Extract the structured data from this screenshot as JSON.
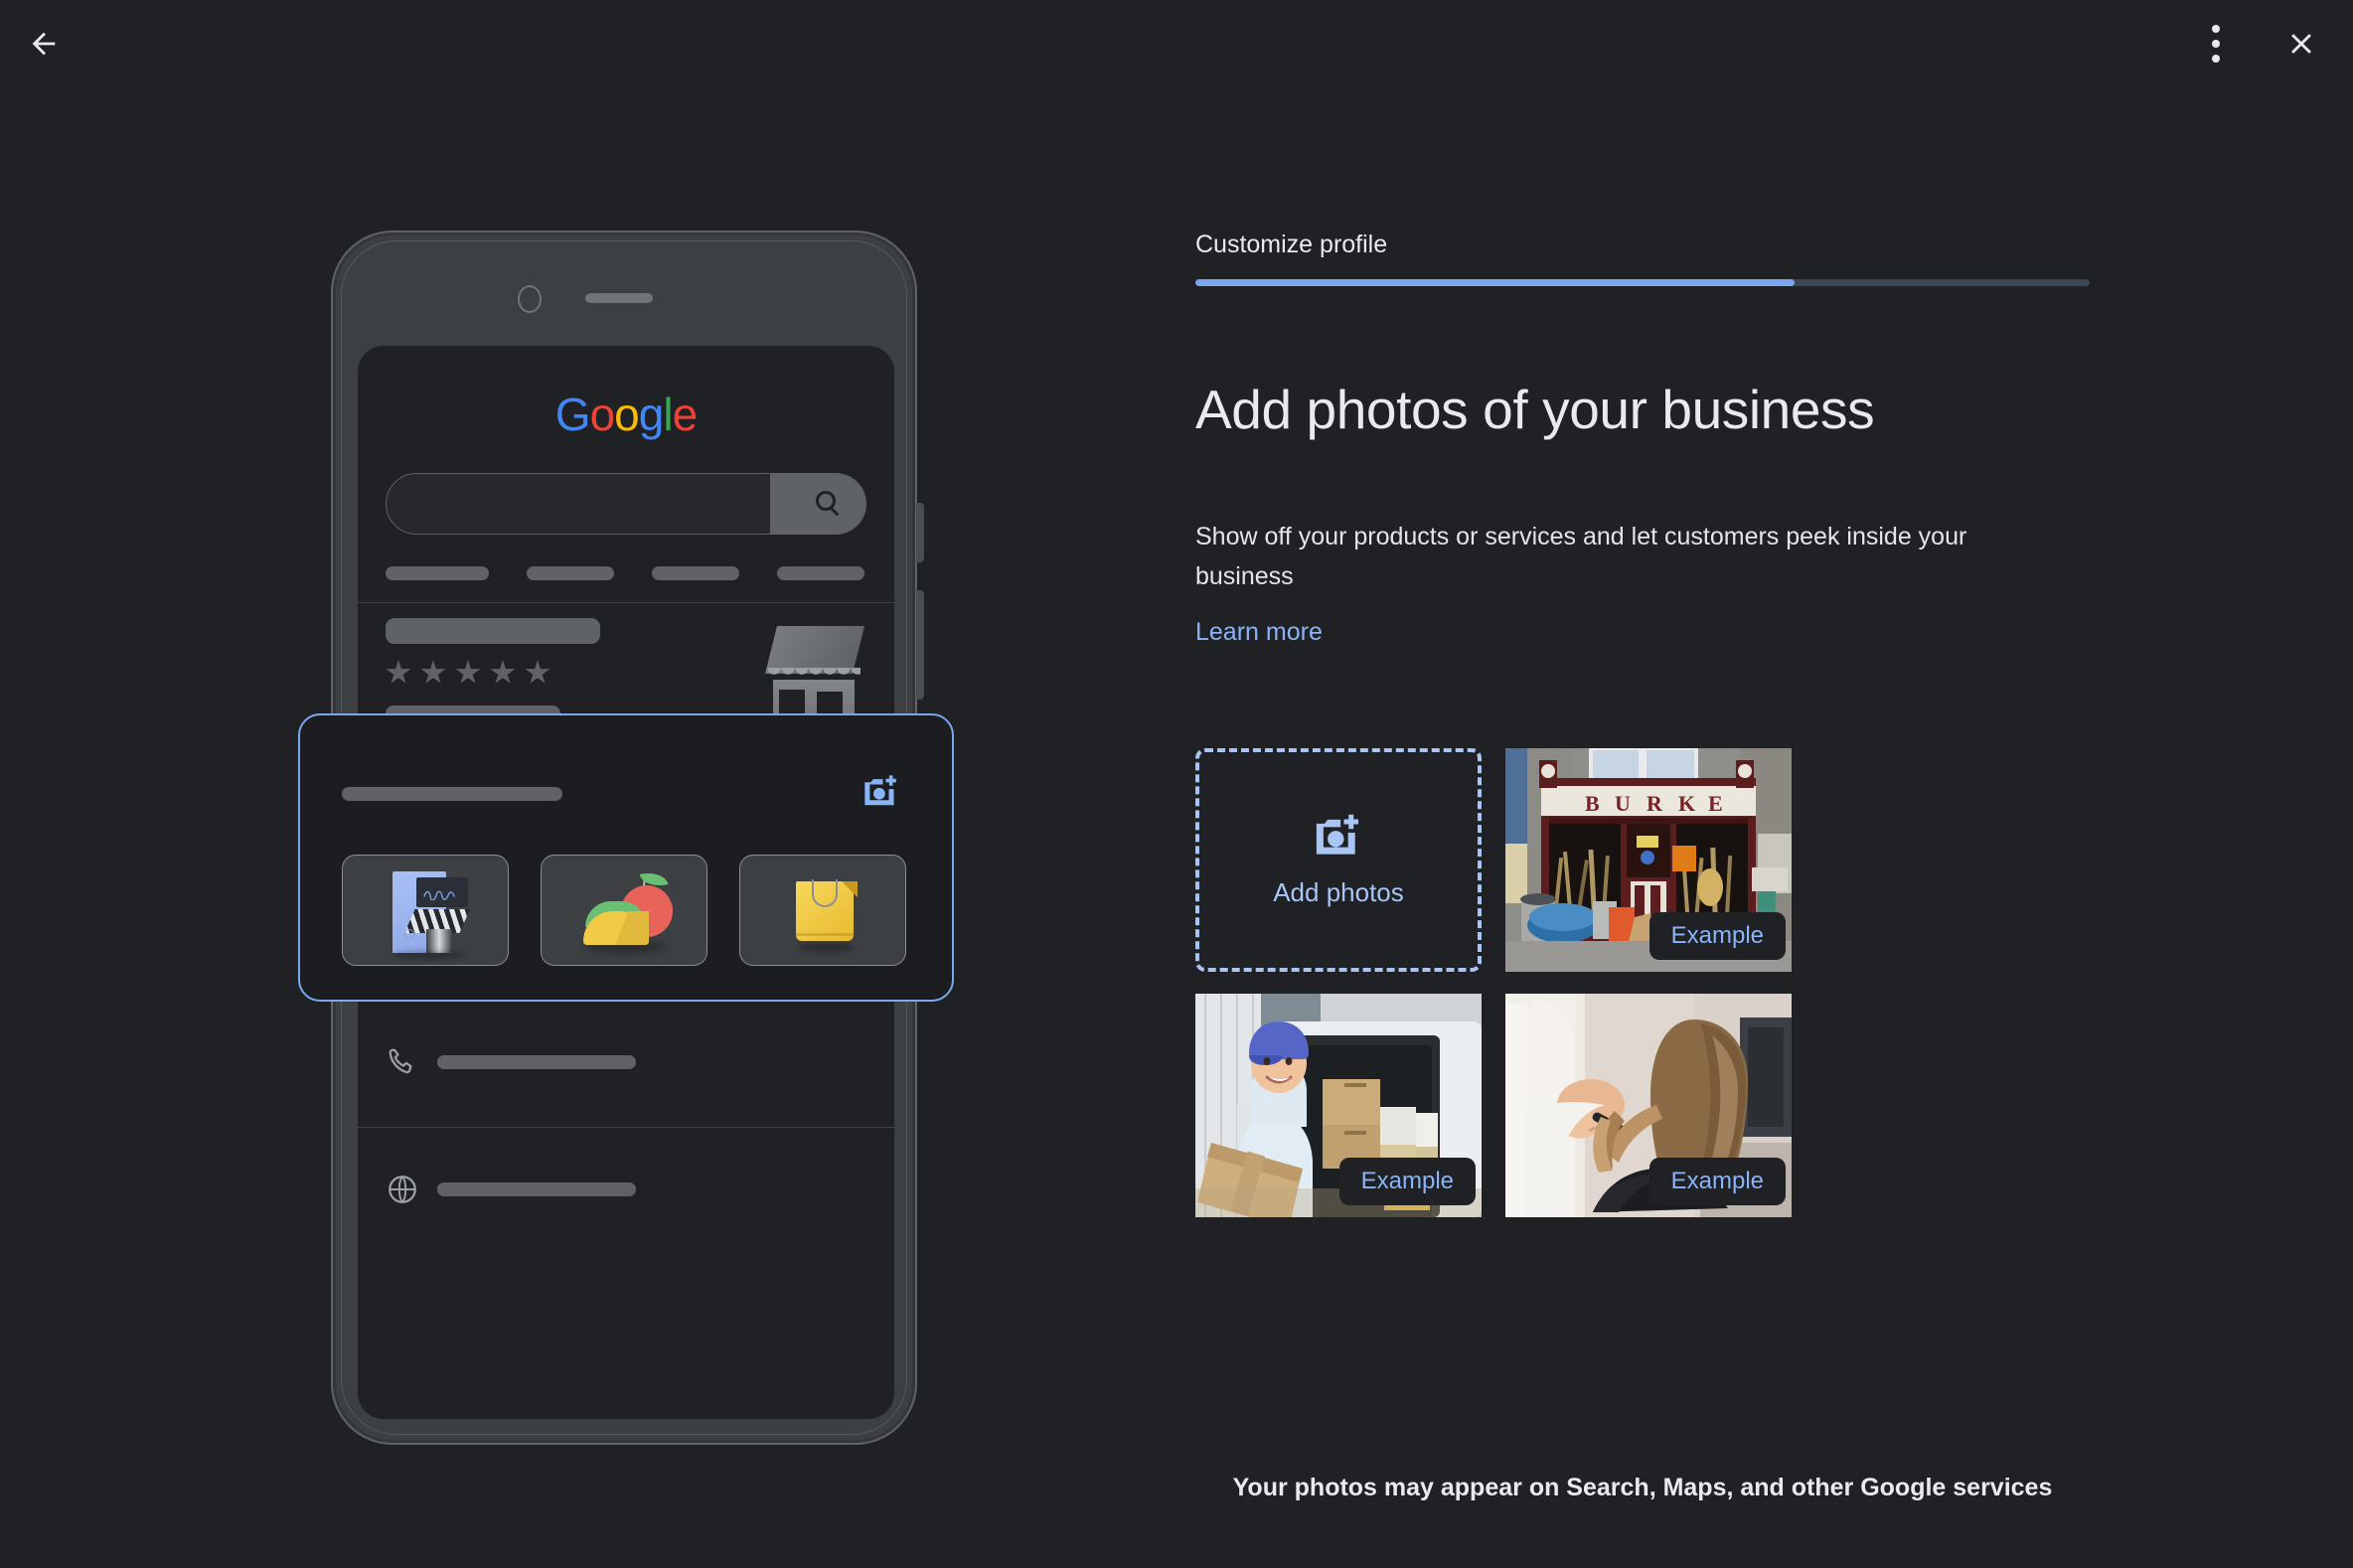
{
  "topbar": {
    "back_icon": "arrow-back-icon",
    "menu_icon": "more-vert-icon",
    "close_icon": "close-icon"
  },
  "progress": {
    "step_label": "Customize profile",
    "percent": 67,
    "fill_color": "#7ba7f0",
    "track_color": "#3c4756"
  },
  "main": {
    "headline": "Add photos of your business",
    "subtext": "Show off your products or services and let customers peek inside your business",
    "learn_more": "Learn more",
    "footer_note": "Your photos may appear on Search, Maps, and other Google services"
  },
  "add_photos": {
    "label": "Add photos",
    "icon": "add-a-photo-icon",
    "accent_color": "#a8c5f5"
  },
  "example_photos": [
    {
      "badge": "Example",
      "alt": "Hardware store front with sign reading BURKE, tools and buckets outside"
    },
    {
      "badge": "Example",
      "alt": "Delivery man in blue cap holding a cardboard box in front of a loaded van"
    },
    {
      "badge": "Example",
      "alt": "Hairdresser combing a woman's long brown hair in a salon"
    }
  ],
  "phone_preview": {
    "google_logo": [
      "G",
      "o",
      "o",
      "g",
      "l",
      "e"
    ],
    "search_icon": "search-icon",
    "rating_stars": 5,
    "info_rows": [
      {
        "icon": "location-pin-icon"
      },
      {
        "icon": "clock-icon"
      },
      {
        "icon": "phone-icon"
      },
      {
        "icon": "globe-icon"
      }
    ]
  },
  "highlight_card": {
    "camera_icon": "add-a-photo-icon",
    "border_color": "#7ba7f0",
    "category_chips": [
      {
        "name": "storefront-illustration"
      },
      {
        "name": "food-illustration"
      },
      {
        "name": "shopping-bag-illustration"
      }
    ]
  }
}
